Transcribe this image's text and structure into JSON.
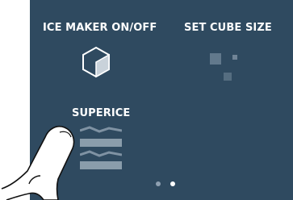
{
  "panel": {
    "ice_maker_label": "ICE MAKER ON/OFF",
    "cube_size_label": "SET CUBE SIZE",
    "superice_label": "SUPERICE"
  },
  "icons": {
    "ice_maker": "ice-cube-icon",
    "cube_size": "cube-size-icon",
    "superice": "superice-icon"
  },
  "pagination": {
    "total_pages": 2,
    "active_page": 2
  },
  "colors": {
    "panel_background": "#2f4a60",
    "text": "#ffffff",
    "dot_inactive": "#8ea0b1",
    "dot_active": "#ffffff"
  }
}
